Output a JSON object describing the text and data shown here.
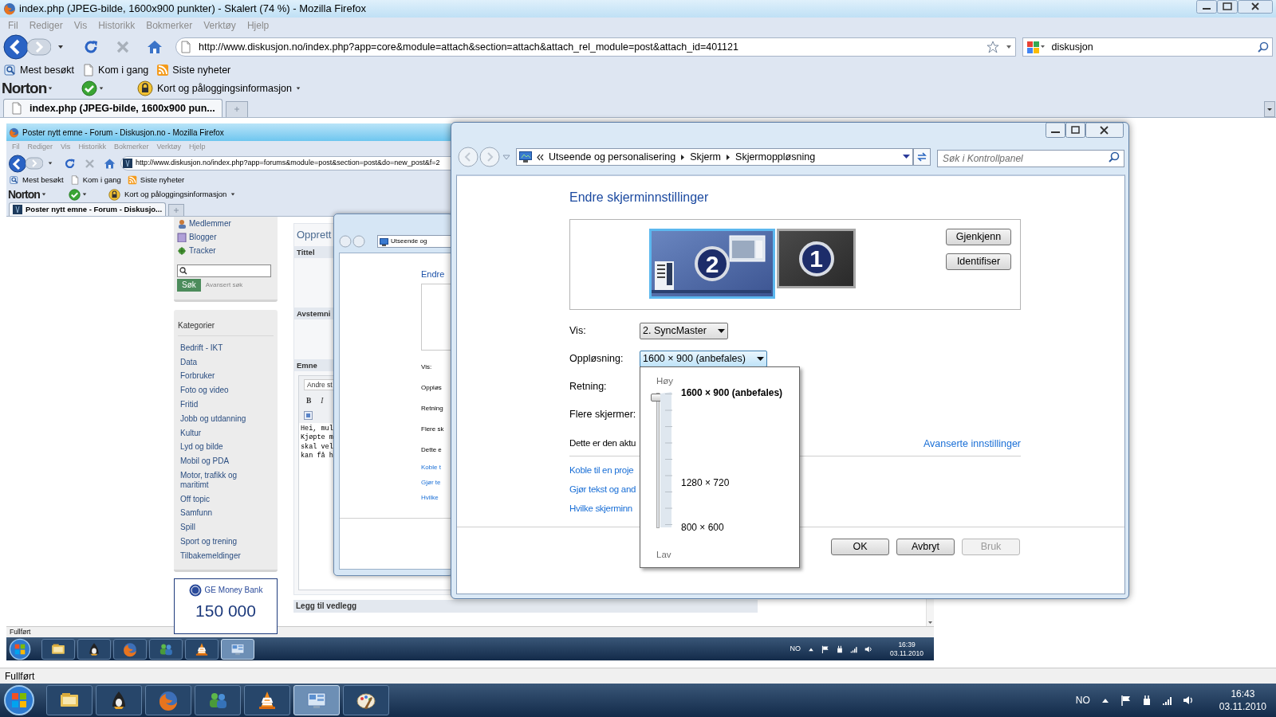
{
  "browser": {
    "title": "index.php (JPEG-bilde, 1600x900 punkter) - Skalert (74 %) - Mozilla Firefox",
    "menu": [
      "Fil",
      "Rediger",
      "Vis",
      "Historikk",
      "Bokmerker",
      "Verktøy",
      "Hjelp"
    ],
    "url": "http://www.diskusjon.no/index.php?app=core&module=attach&section=attach&attach_rel_module=post&attach_id=401121",
    "search": "diskusjon",
    "bookmarks": [
      "Mest besøkt",
      "Kom i gang",
      "Siste nyheter"
    ],
    "norton": {
      "logo": "Norton",
      "vault": "Kort og påloggingsinformasjon"
    },
    "tabs": [
      {
        "label": "index.php (JPEG-bilde, 1600x900 pun...",
        "selected": true
      }
    ],
    "status": "Fullført"
  },
  "image": {
    "title": "Poster nytt emne - Forum - Diskusjon.no - Mozilla Firefox",
    "menu": [
      "Fil",
      "Rediger",
      "Vis",
      "Historikk",
      "Bokmerker",
      "Verktøy",
      "Hjelp"
    ],
    "url": "http://www.diskusjon.no/index.php?app=forums&module=post&section=post&do=new_post&f=2",
    "bookmarks": [
      "Mest besøkt",
      "Kom i gang",
      "Siste nyheter"
    ],
    "norton": {
      "logo": "Norton",
      "vault": "Kort og påloggingsinformasjon"
    },
    "tabs": [
      {
        "label": "Poster nytt emne - Forum - Diskusjo...",
        "selected": true
      }
    ],
    "sidebar_links": [
      "Medlemmer",
      "Blogger",
      "Tracker"
    ],
    "search_button": "Søk",
    "advanced_search": "Avansert søk",
    "categories": {
      "heading": "Kategorier",
      "items": [
        "Bedrift - IKT",
        "Data",
        "Forbruker",
        "Foto og video",
        "Fritid",
        "Jobb og utdanning",
        "Kultur",
        "Lyd og bilde",
        "Mobil og PDA",
        "Motor, trafikk og maritimt",
        "Off topic",
        "Samfunn",
        "Spill",
        "Sport og trening",
        "Tilbakemeldinger"
      ]
    },
    "ad": {
      "brand": "GE Money Bank",
      "amount": "150 000"
    },
    "post": {
      "title": "Opprett",
      "sections": [
        "Tittel",
        "Avstemni",
        "Emne"
      ],
      "style_select": "Andre st",
      "bold": "B",
      "italic": "I",
      "body_lines": [
        "Hei, mul",
        "Kjøpte m",
        "skal vel",
        "kan få h"
      ],
      "attach": "Legg til vedlegg"
    },
    "dialog": {
      "breadcrumb": "Utseende og",
      "heading": "Endre",
      "labels": [
        "Vis:",
        "Oppløs",
        "Retning",
        "Flere sk",
        "Dette e"
      ],
      "links": [
        "Koble t",
        "Gjør te",
        "Hvilke"
      ]
    },
    "status": "Fullført",
    "taskbar": {
      "apps": [
        {
          "kind": "explorer",
          "active": false
        },
        {
          "kind": "penguin",
          "active": false
        },
        {
          "kind": "firefox",
          "active": false
        },
        {
          "kind": "people",
          "active": false
        },
        {
          "kind": "cone",
          "active": false
        },
        {
          "kind": "display",
          "active": true
        }
      ],
      "language": "NO",
      "time": "16:39",
      "date": "03.11.2010"
    }
  },
  "dialog": {
    "breadcrumb": [
      "Utseende og personalisering",
      "Skjerm",
      "Skjermoppløsning"
    ],
    "search_placeholder": "Søk i Kontrollpanel",
    "heading": "Endre skjerminnstillinger",
    "monitors": [
      {
        "number": "2",
        "selected": true
      },
      {
        "number": "1",
        "selected": false
      }
    ],
    "monitor_buttons": [
      "Gjenkjenn",
      "Identifiser"
    ],
    "fields": [
      {
        "label": "Vis:",
        "value": "2. SyncMaster",
        "open": false
      },
      {
        "label": "Oppløsning:",
        "value": "1600 × 900 (anbefales)",
        "open": true
      },
      {
        "label": "Retning:"
      },
      {
        "label": "Flere skjermer:"
      }
    ],
    "info": "Dette er den aktu",
    "advanced_link": "Avanserte innstillinger",
    "links": [
      "Koble til en proje",
      "Gjør tekst og and",
      "Hvilke skjerminn"
    ],
    "buttons": [
      {
        "label": "OK",
        "disabled": false
      },
      {
        "label": "Avbryt",
        "disabled": false
      },
      {
        "label": "Bruk",
        "disabled": true
      }
    ]
  },
  "resolution_popup": {
    "high": "Høy",
    "low": "Lav",
    "level": 1,
    "options": [
      {
        "label": "1600 × 900 (anbefales)",
        "selected": true
      },
      {
        "label": "1280 × 720",
        "selected": false
      },
      {
        "label": "800 × 600",
        "selected": false
      }
    ]
  },
  "taskbar": {
    "apps": [
      {
        "kind": "explorer",
        "active": false
      },
      {
        "kind": "penguin",
        "active": false
      },
      {
        "kind": "firefox",
        "active": false
      },
      {
        "kind": "people",
        "active": false
      },
      {
        "kind": "cone",
        "active": false
      },
      {
        "kind": "display",
        "active": true
      },
      {
        "kind": "paint",
        "active": false
      }
    ],
    "language": "NO",
    "time": "16:43",
    "date": "03.11.2010"
  }
}
